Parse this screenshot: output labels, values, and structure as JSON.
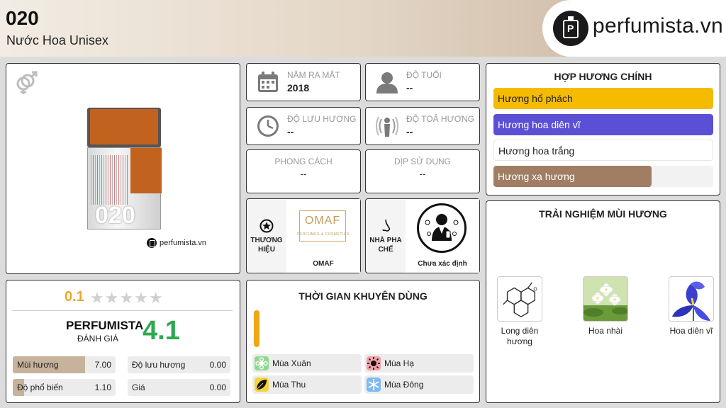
{
  "header": {
    "product_name": "020",
    "product_subtitle": "Nước Hoa Unisex",
    "brand_site": "perfumista.vn"
  },
  "product_card": {
    "gender_icon": "unisex-gender-icon",
    "bottle_number": "020",
    "watermark": "perfumista.vn"
  },
  "info": {
    "release_year": {
      "label": "NĂM RA MẮT",
      "value": "2018",
      "icon": "calendar-icon"
    },
    "age": {
      "label": "ĐỘ TUỔI",
      "value": "--",
      "icon": "person-icon"
    },
    "longevity": {
      "label": "ĐỘ LƯU HƯƠNG",
      "value": "--",
      "icon": "clock-icon"
    },
    "sillage": {
      "label": "ĐỘ TOẢ HƯƠNG",
      "value": "--",
      "icon": "sillage-icon"
    },
    "style": {
      "label": "PHONG CÁCH",
      "value": "--"
    },
    "occasion": {
      "label": "DỊP SỬ DỤNG",
      "value": "--"
    }
  },
  "brand": {
    "label": "THƯƠNG HIỆU",
    "name": "OMAF",
    "logo_text": "OMAF",
    "logo_sub": "PERFUMES & COSMETICS",
    "icon": "star-badge-icon"
  },
  "perfumer": {
    "label": "NHÀ PHA CHẾ",
    "name": "Chưa xác định",
    "icon": "nose-icon"
  },
  "accords": {
    "title": "HỢP HƯƠNG CHÍNH",
    "items": [
      {
        "label": "Hương hổ phách",
        "color": "#f5bb00",
        "text_color": "#222222",
        "level": 1.0
      },
      {
        "label": "Hương hoa diên vĩ",
        "color": "#5b4fd6",
        "text_color": "#ffffff",
        "level": 1.0
      },
      {
        "label": "Hương hoa trắng",
        "color": "#ffffff",
        "text_color": "#222222",
        "level": 1.0
      },
      {
        "label": "Hương xạ hương",
        "color": "#a07d63",
        "text_color": "#ffffff",
        "level": 0.72
      }
    ]
  },
  "notes": {
    "title": "TRẢI NGHIỆM MÙI HƯƠNG",
    "items": [
      {
        "label": "Long diên hương",
        "icon": "molecule-icon"
      },
      {
        "label": "Hoa nhài",
        "icon": "jasmine-icon"
      },
      {
        "label": "Hoa diên vĩ",
        "icon": "iris-icon"
      }
    ]
  },
  "rating": {
    "user_score": "0.1",
    "stars": "★★★★★",
    "user_fraction": 0.02,
    "perfumista_title": "PERFUMISTA",
    "perfumista_subtitle": "ĐÁNH GIÁ",
    "perfumista_score": "4.1",
    "metrics": [
      {
        "label": "Mùi hương",
        "value": "7.00",
        "level": 0.7
      },
      {
        "label": "Độ lưu hương",
        "value": "0.00",
        "level": 0.0
      },
      {
        "label": "Độ phổ biến",
        "value": "1.10",
        "level": 0.11
      },
      {
        "label": "Giá",
        "value": "0.00",
        "level": 0.0
      }
    ]
  },
  "seasons": {
    "title": "THỜI GIAN KHUYÊN DÙNG",
    "items": [
      {
        "label": "Mùa Xuân",
        "icon": "spring-flower-icon",
        "color": "#8fd98f"
      },
      {
        "label": "Mùa Hạ",
        "icon": "sun-icon",
        "color": "#f2a1a8"
      },
      {
        "label": "Mùa Thu",
        "icon": "leaf-icon",
        "color": "#f3d53b"
      },
      {
        "label": "Mùa Đông",
        "icon": "snowflake-icon",
        "color": "#7fb8f0"
      }
    ]
  }
}
